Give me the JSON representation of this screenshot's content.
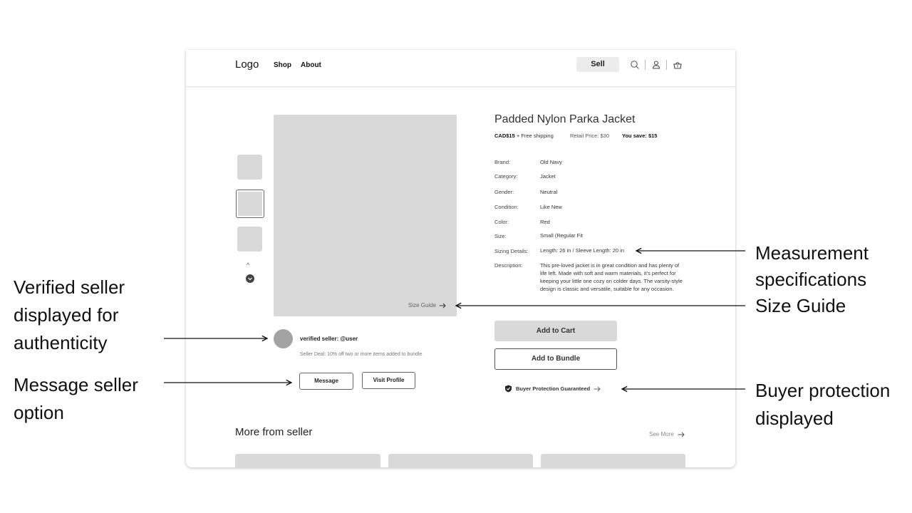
{
  "nav": {
    "logo": "Logo",
    "links": [
      "Shop",
      "About"
    ],
    "sell_label": "Sell",
    "icons": [
      "search-icon",
      "user-icon",
      "basket-icon"
    ]
  },
  "gallery": {
    "size_guide": "Size Guide"
  },
  "product": {
    "title": "Padded Nylon Parka Jacket",
    "price": "CAD$15",
    "shipping": " + Free shipping",
    "retail": "Retail Price: $30",
    "save": "You save: $15",
    "specs": [
      {
        "label": "Brand:",
        "value": "Old Navy"
      },
      {
        "label": "Category:",
        "value": "Jacket"
      },
      {
        "label": "Gender:",
        "value": "Neutral"
      },
      {
        "label": "Condition:",
        "value": "Like New"
      },
      {
        "label": "Color:",
        "value": "Red"
      },
      {
        "label": "Size:",
        "value": "Small  (Regular Fit"
      },
      {
        "label": "Sizing Details:",
        "value": "Length: 26 in / Sleeve Length: 20 in"
      }
    ],
    "description_label": "Description:",
    "description": "This pre-loved jacket is in great condition and has plenty of life left. Made with soft and warm materials, it's perfect for keeping your little one cozy on colder days. The varsity-style design is classic and versatile, suitable for any occasion."
  },
  "actions": {
    "add_to_cart": "Add to Cart",
    "add_to_bundle": "Add to Bundle",
    "protection": "Buyer Protection Guaranteed"
  },
  "seller": {
    "name": "verified seller: @user",
    "deal": "Seller Deal: 10% off two or more items added to bundle",
    "message": "Message",
    "visit": "Visit Profile"
  },
  "more": {
    "title": "More from seller",
    "see_more": "See More"
  },
  "annotations": {
    "verified": [
      "Verified seller",
      "displayed for",
      "authenticity"
    ],
    "message": [
      "Message seller",
      "option"
    ],
    "measurement": [
      "Measurement",
      "specifications",
      "Size Guide"
    ],
    "protection": [
      "Buyer protection",
      "displayed"
    ]
  }
}
